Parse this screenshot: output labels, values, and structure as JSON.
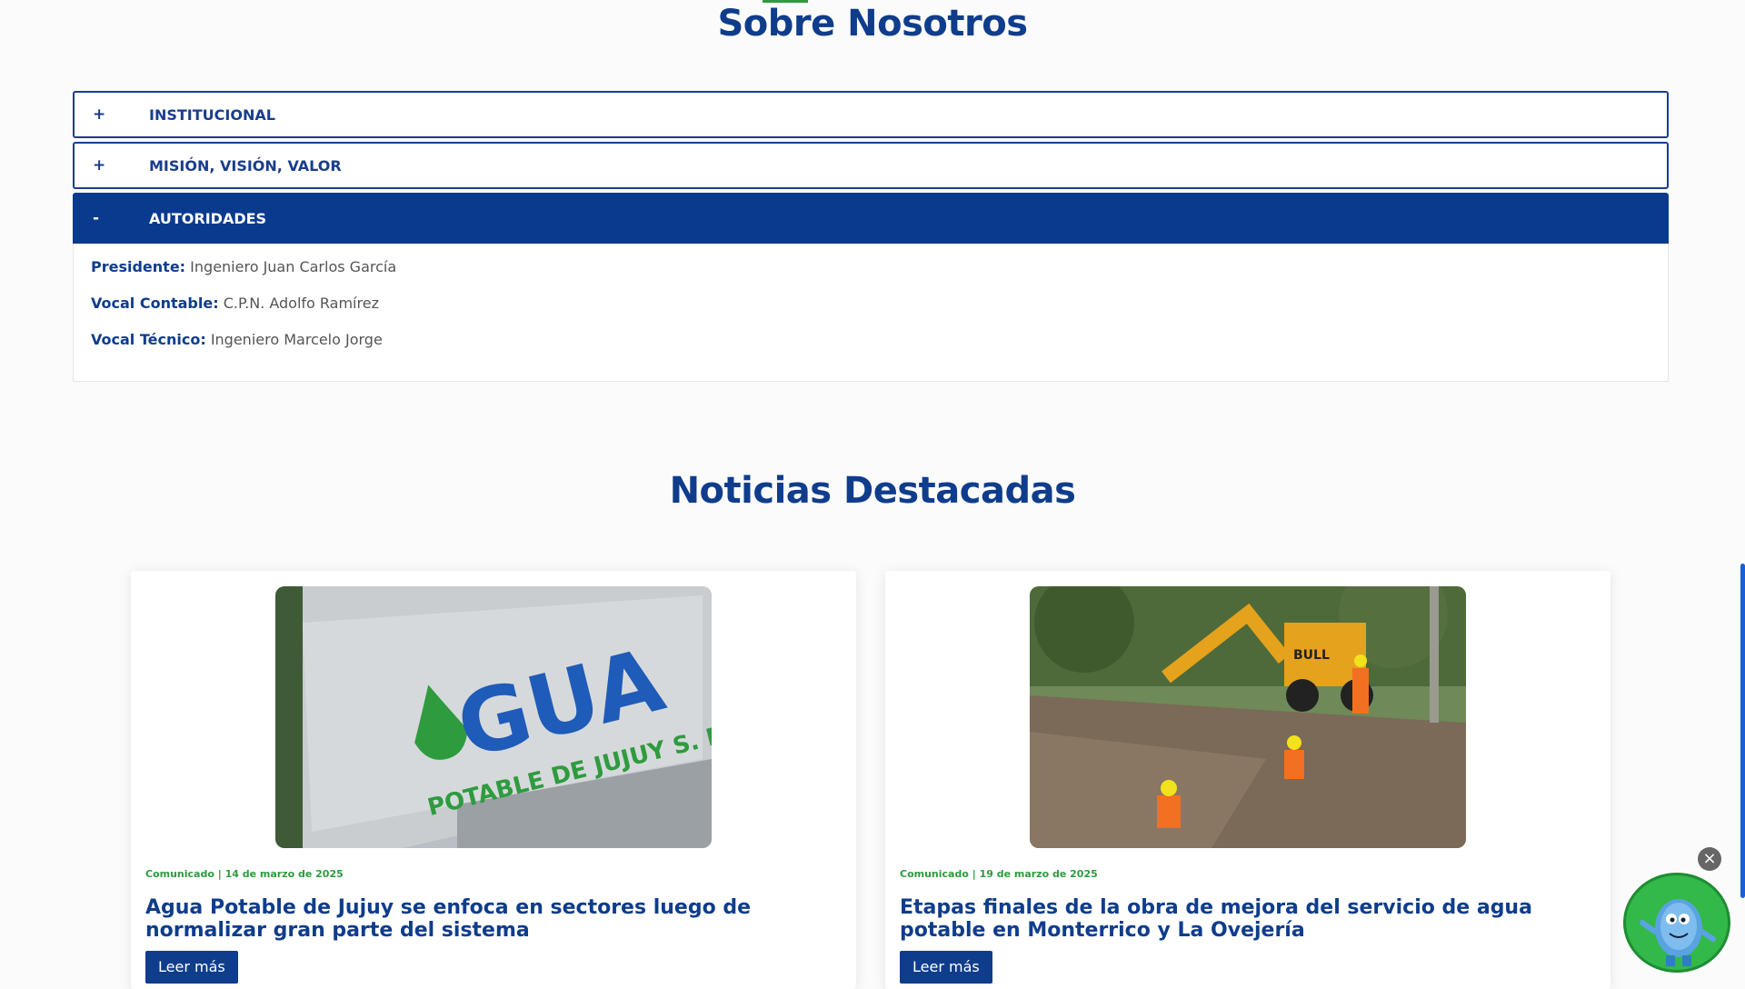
{
  "about": {
    "title": "Sobre Nosotros",
    "accordion": [
      {
        "sign": "+",
        "label": "INSTITUCIONAL"
      },
      {
        "sign": "+",
        "label": "MISIÓN, VISIÓN, VALOR"
      },
      {
        "sign": "-",
        "label": "AUTORIDADES"
      }
    ],
    "authorities": [
      {
        "role": "Presidente:",
        "name": "Ingeniero Juan Carlos García"
      },
      {
        "role": "Vocal Contable:",
        "name": "C.P.N. Adolfo Ramírez"
      },
      {
        "role": "Vocal Técnico:",
        "name": "Ingeniero Marcelo Jorge"
      }
    ]
  },
  "news": {
    "title": "Noticias Destacadas",
    "cards": [
      {
        "meta": "Comunicado | 14 de marzo de 2025",
        "title": "Agua Potable de Jujuy se enfoca en sectores luego de normalizar gran parte del sistema",
        "button": "Leer más",
        "image_text": {
          "big": "GUA",
          "small": "POTABLE DE JUJUY S. E."
        }
      },
      {
        "meta": "Comunicado | 19 de marzo de 2025",
        "title": "Etapas finales de la obra de mejora del servicio de agua potable en Monterrico y La Ovejería",
        "button": "Leer más",
        "image_text": {
          "machine": "BULL"
        }
      }
    ]
  },
  "chat": {
    "close": "×"
  },
  "colors": {
    "brand_blue": "#0f3d8c",
    "accent_green": "#2e9b3f"
  }
}
